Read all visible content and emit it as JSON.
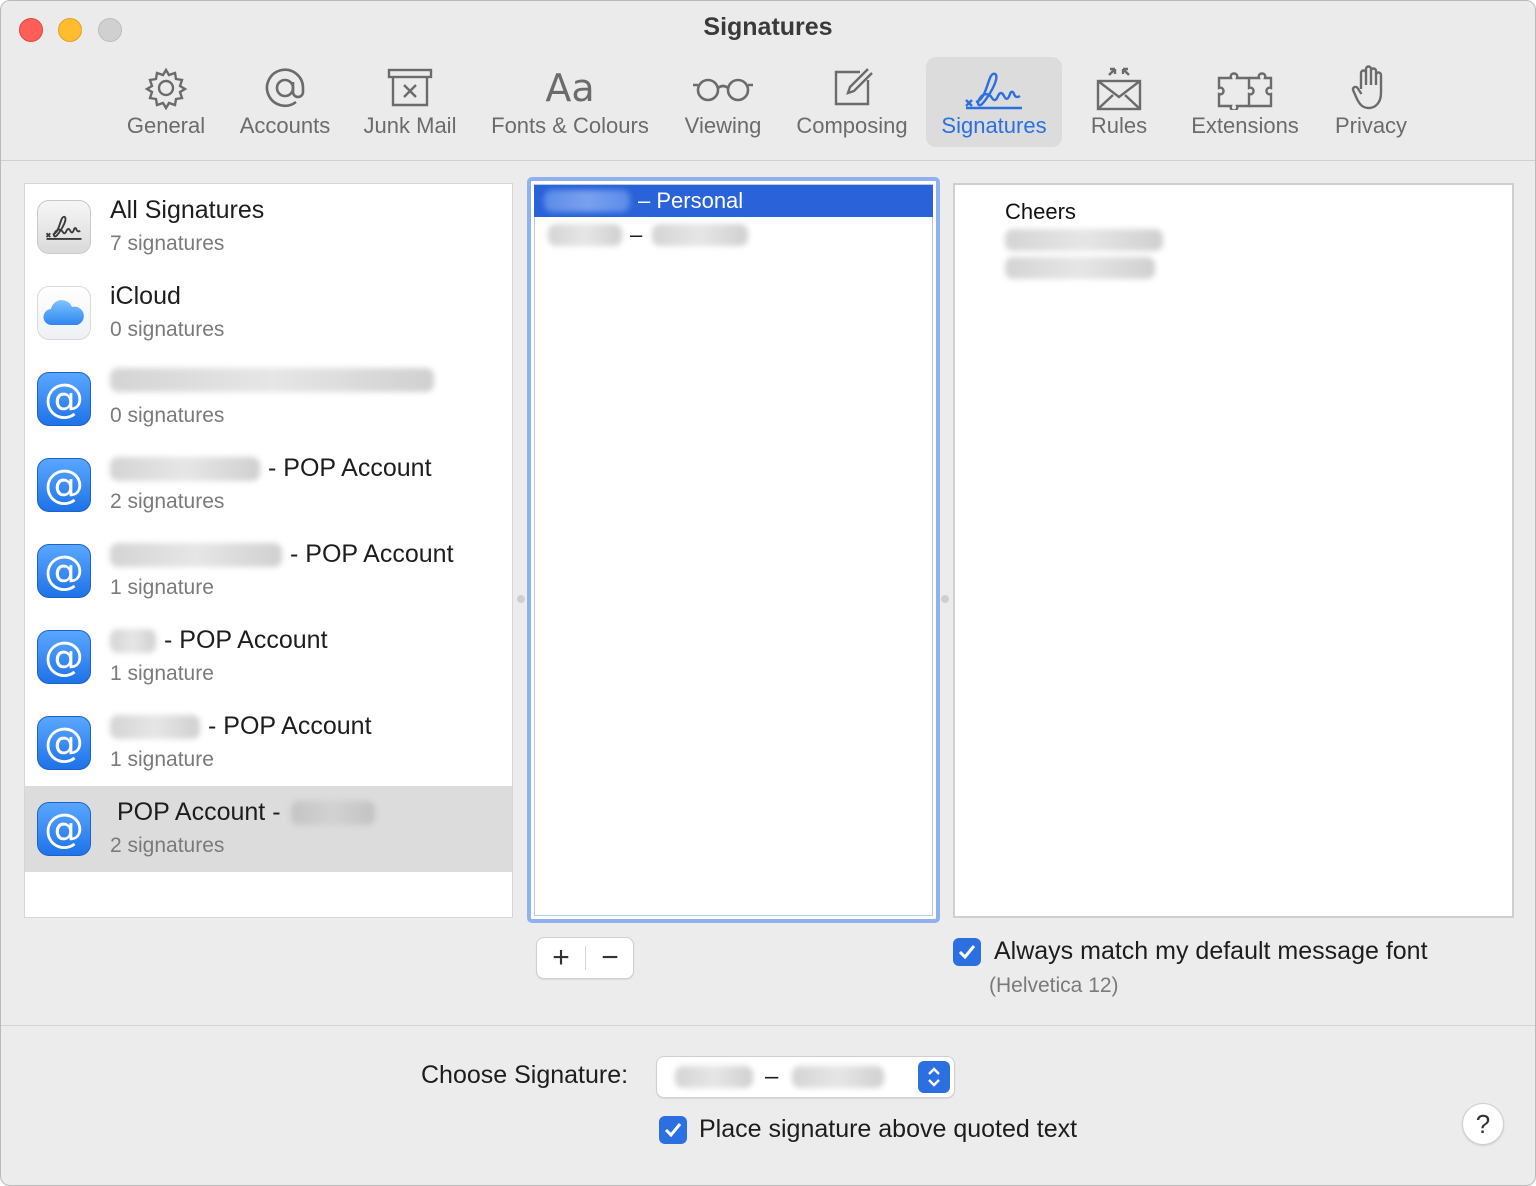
{
  "window": {
    "title": "Signatures"
  },
  "toolbar": {
    "tabs": [
      {
        "label": "General",
        "icon": "gear-icon"
      },
      {
        "label": "Accounts",
        "icon": "at-icon"
      },
      {
        "label": "Junk Mail",
        "icon": "junk-tray-icon"
      },
      {
        "label": "Fonts & Colours",
        "icon": "font-icon"
      },
      {
        "label": "Viewing",
        "icon": "glasses-icon"
      },
      {
        "label": "Composing",
        "icon": "compose-icon"
      },
      {
        "label": "Signatures",
        "icon": "signature-icon",
        "active": true
      },
      {
        "label": "Rules",
        "icon": "envelope-rules-icon"
      },
      {
        "label": "Extensions",
        "icon": "puzzle-icon"
      },
      {
        "label": "Privacy",
        "icon": "hand-icon"
      }
    ],
    "active_color": "#2b6fe0"
  },
  "accounts": [
    {
      "name": "All Signatures",
      "count": "7 signatures",
      "icon": "signature-icon"
    },
    {
      "name": "iCloud",
      "count": "0 signatures",
      "icon": "icloud-icon"
    },
    {
      "name": "",
      "count": "0 signatures",
      "icon": "at-icon"
    },
    {
      "name": "- POP Account",
      "count": "2 signatures",
      "icon": "at-icon"
    },
    {
      "name": "- POP Account",
      "count": "1 signature",
      "icon": "at-icon"
    },
    {
      "name": "- POP Account",
      "count": "1 signature",
      "icon": "at-icon"
    },
    {
      "name": "- POP Account",
      "count": "1 signature",
      "icon": "at-icon"
    },
    {
      "name": "POP Account -",
      "count": "2 signatures",
      "icon": "at-icon",
      "selected": true
    }
  ],
  "signatures": [
    {
      "label": "– Personal",
      "selected": true
    },
    {
      "label": "–",
      "selected": false
    }
  ],
  "sig_buttons": {
    "add": "+",
    "remove": "−"
  },
  "editor": {
    "first_line": "Cheers"
  },
  "font_option": {
    "label": "Always match my default message font",
    "checked": true,
    "font_note": "(Helvetica 12)"
  },
  "choose_signature": {
    "label": "Choose Signature:",
    "value_separator": "–"
  },
  "place_above": {
    "label": "Place signature above quoted text",
    "checked": true
  },
  "help": {
    "label": "?"
  }
}
